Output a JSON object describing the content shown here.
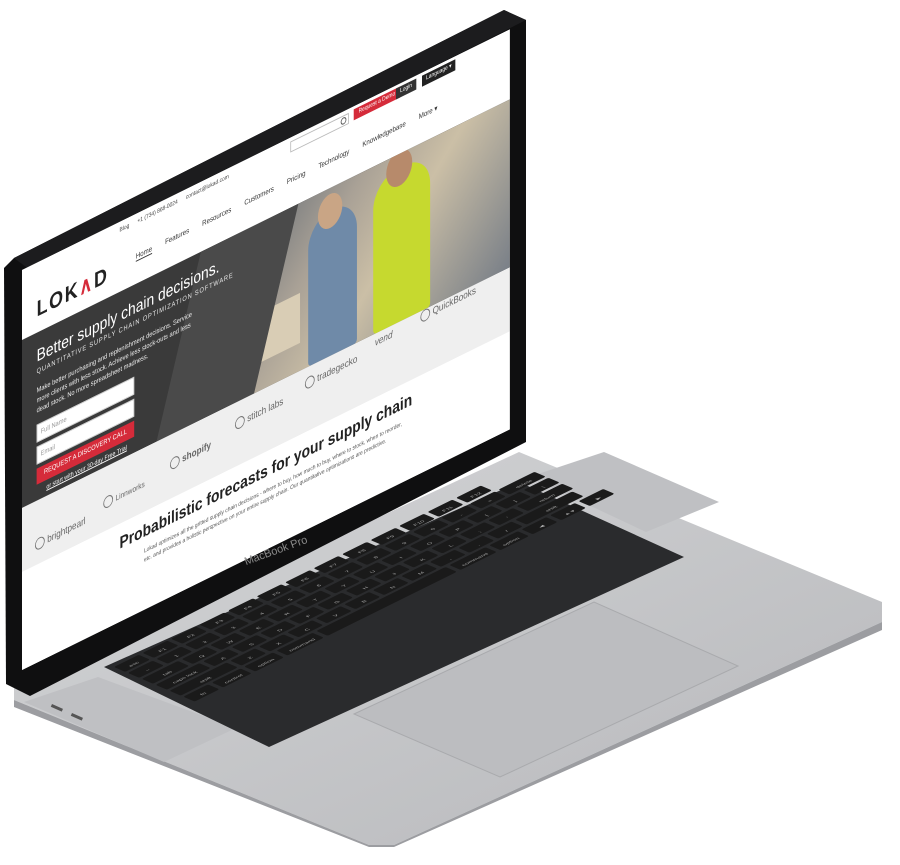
{
  "device": {
    "label": "MacBook Pro"
  },
  "site": {
    "logo": {
      "pre": "LOK",
      "accent": "∧",
      "post": "D"
    },
    "topbar": {
      "blog": "Blog",
      "phone": "+1 (734) 868-0024",
      "email": "contact@lokad.com",
      "search_placeholder": "",
      "demo_button": "Request a Demo",
      "login_button": "Login",
      "language_button": "Language ▾"
    },
    "nav": {
      "items": [
        "Home",
        "Features",
        "Resources",
        "Customers",
        "Pricing",
        "Technology",
        "Knowledgebase",
        "More ▾"
      ]
    },
    "hero": {
      "title": "Better supply chain decisions.",
      "subtitle": "QUANTITATIVE SUPPLY CHAIN OPTIMIZATION SOFTWARE",
      "description": "Make better purchasing and replenishment decisions. Service more clients with less stock. Achieve less stock-outs and less dead stock. No more spreadsheet madness.",
      "name_placeholder": "Full Name",
      "email_placeholder": "Email",
      "cta_button": "REQUEST A DISCOVERY CALL",
      "trial_link": "or start with your 30-day Free Trial"
    },
    "partners": [
      "brightpearl",
      "Linnworks",
      "shopify",
      "stitch labs",
      "tradegecko",
      "vend",
      "QuickBooks"
    ],
    "section": {
      "title": "Probabilistic forecasts for your supply chain",
      "text": "Lokad optimizes all the gritted supply chain decisions - where to buy, how much to buy, where to stock, when to reorder, etc. and provides a holistic perspective on your entire supply chain. Our quantitative optimizations are predictive."
    }
  },
  "keyboard": {
    "rows": [
      [
        "esc",
        "F1",
        "F2",
        "F3",
        "F4",
        "F5",
        "F6",
        "F7",
        "F8",
        "F9",
        "F10",
        "F11",
        "F12"
      ],
      [
        "~",
        "1",
        "2",
        "3",
        "4",
        "5",
        "6",
        "7",
        "8",
        "9",
        "0",
        "-",
        "=",
        "delete"
      ],
      [
        "tab",
        "Q",
        "W",
        "E",
        "R",
        "T",
        "Y",
        "U",
        "I",
        "O",
        "P",
        "[",
        "]",
        "\\"
      ],
      [
        "caps lock",
        "A",
        "S",
        "D",
        "F",
        "G",
        "H",
        "J",
        "K",
        "L",
        ";",
        "'",
        "return"
      ],
      [
        "shift",
        "Z",
        "X",
        "C",
        "V",
        "B",
        "N",
        "M",
        ",",
        ".",
        "/",
        "shift"
      ],
      [
        "fn",
        "control",
        "option",
        "command",
        "",
        "command",
        "option",
        "◀",
        "▲▼",
        "▶"
      ]
    ]
  },
  "colors": {
    "brand_red": "#d52b3a",
    "hero_dark": "#3a3a3a",
    "chassis": "#c9cacc",
    "bezel": "#0f0f10"
  }
}
